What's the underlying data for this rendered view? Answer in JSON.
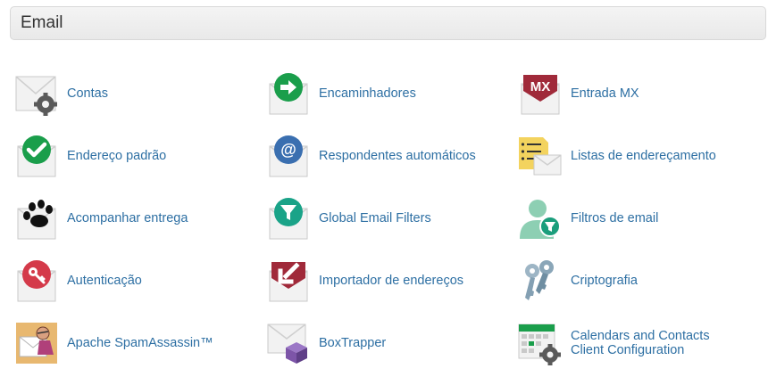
{
  "section": {
    "title": "Email"
  },
  "items": [
    {
      "label": "Contas",
      "icon": "mail-gear-icon"
    },
    {
      "label": "Encaminhadores",
      "icon": "mail-forward-icon"
    },
    {
      "label": "Entrada MX",
      "icon": "mail-mx-icon",
      "badge": "MX"
    },
    {
      "label": "Endereço padrão",
      "icon": "mail-check-icon"
    },
    {
      "label": "Respondentes automáticos",
      "icon": "mail-at-icon",
      "badge": "@"
    },
    {
      "label": "Listas de endereçamento",
      "icon": "mailing-list-icon"
    },
    {
      "label": "Acompanhar entrega",
      "icon": "mail-pawprint-icon"
    },
    {
      "label": "Global Email Filters",
      "icon": "mail-global-filter-icon"
    },
    {
      "label": "Filtros de email",
      "icon": "user-filter-icon"
    },
    {
      "label": "Autenticação",
      "icon": "mail-key-icon"
    },
    {
      "label": "Importador de endereços",
      "icon": "mail-import-icon"
    },
    {
      "label": "Criptografia",
      "icon": "keys-icon"
    },
    {
      "label": "Apache SpamAssassin™",
      "icon": "spamassassin-icon"
    },
    {
      "label": "BoxTrapper",
      "icon": "mail-box-icon"
    },
    {
      "label_lines": [
        "Calendars and Contacts",
        "Client Configuration"
      ],
      "icon": "calendar-gear-icon"
    }
  ],
  "colors": {
    "link": "#2d6fa3",
    "green": "#1a9e4b",
    "teal": "#1aa388",
    "blue": "#3a6fb0",
    "maroon": "#a02a3a",
    "red": "#d43a4a",
    "purple": "#7d55a8"
  }
}
